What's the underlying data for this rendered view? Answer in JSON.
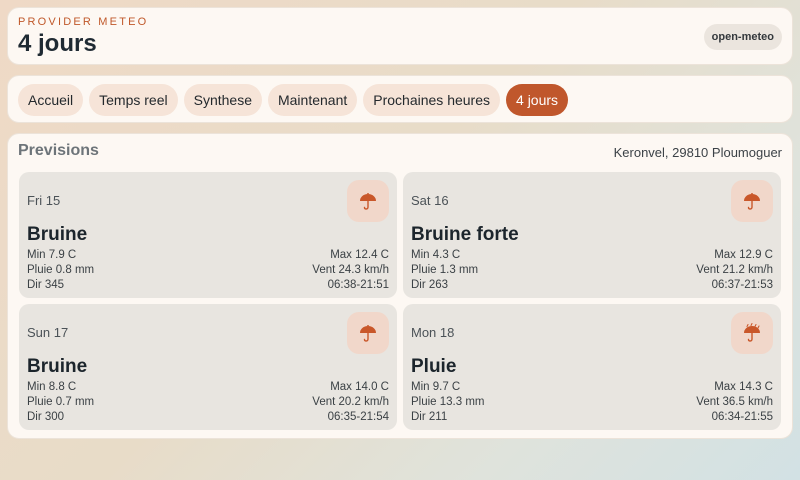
{
  "header": {
    "kicker": "PROVIDER METEO",
    "title": "4 jours",
    "badge": "open-meteo"
  },
  "nav": {
    "tabs": [
      {
        "label": "Accueil",
        "active": false
      },
      {
        "label": "Temps reel",
        "active": false
      },
      {
        "label": "Synthese",
        "active": false
      },
      {
        "label": "Maintenant",
        "active": false
      },
      {
        "label": "Prochaines heures",
        "active": false
      },
      {
        "label": "4 jours",
        "active": true
      }
    ]
  },
  "panel": {
    "title": "Previsions",
    "location": "Keronvel, 29810 Ploumoguer",
    "days": [
      {
        "day": "Fri 15",
        "icon": "umbrella-icon",
        "condition": "Bruine",
        "min": "Min 7.9 C",
        "max": "Max 12.4 C",
        "rain": "Pluie 0.8 mm",
        "wind": "Vent 24.3 km/h",
        "dir": "Dir 345",
        "sun": "06:38-21:51"
      },
      {
        "day": "Sat 16",
        "icon": "umbrella-icon",
        "condition": "Bruine forte",
        "min": "Min 4.3 C",
        "max": "Max 12.9 C",
        "rain": "Pluie 1.3 mm",
        "wind": "Vent 21.2 km/h",
        "dir": "Dir 263",
        "sun": "06:37-21:53"
      },
      {
        "day": "Sun 17",
        "icon": "umbrella-icon",
        "condition": "Bruine",
        "min": "Min 8.8 C",
        "max": "Max 14.0 C",
        "rain": "Pluie 0.7 mm",
        "wind": "Vent 20.2 km/h",
        "dir": "Dir 300",
        "sun": "06:35-21:54"
      },
      {
        "day": "Mon 18",
        "icon": "umbrella-rain-icon",
        "condition": "Pluie",
        "min": "Min 9.7 C",
        "max": "Max 14.3 C",
        "rain": "Pluie 13.3 mm",
        "wind": "Vent 36.5 km/h",
        "dir": "Dir 211",
        "sun": "06:34-21:55"
      }
    ]
  },
  "colors": {
    "accent": "#c0572c",
    "tab_bg": "#f6e4d8",
    "icon_bg": "#f1d7ca",
    "card_bg": "#fdf8f3",
    "day_bg": "#e8e5e0"
  }
}
